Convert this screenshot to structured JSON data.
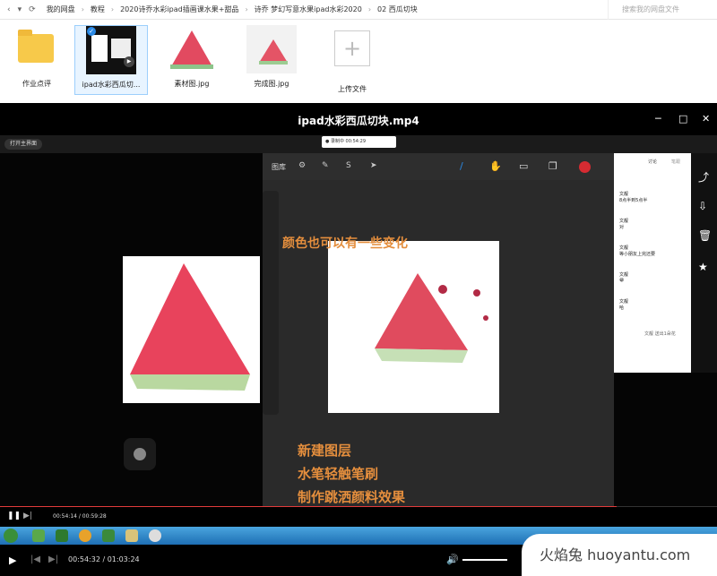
{
  "breadcrumb": [
    "我的网盘",
    "教程",
    "2020诗乔水彩ipad插画课水果+甜品",
    "诗乔 梦幻写意水果ipad水彩2020",
    "02 西瓜切块"
  ],
  "search": {
    "placeholder": "搜索我的网盘文件"
  },
  "files": [
    {
      "name": "作业点评",
      "kind": "folder"
    },
    {
      "name": "ipad水彩西瓜切...",
      "kind": "video"
    },
    {
      "name": "素材图.jpg",
      "kind": "image"
    },
    {
      "name": "完成图.jpg",
      "kind": "image"
    },
    {
      "name": "上传文件",
      "kind": "upload"
    }
  ],
  "video": {
    "title": "ipad水彩西瓜切块.mp4"
  },
  "recording": {
    "chip": "打开主界面",
    "time": "● 录制中 00:54:29"
  },
  "procreate": {
    "gallery": "图库"
  },
  "caption_top": "颜色也可以有一些变化",
  "caption_bottom": [
    "新建图层",
    "水笔轻触笔刷",
    "制作跳洒颜料效果"
  ],
  "chat": {
    "tabs": [
      "讨论",
      "笔跟"
    ],
    "messages": [
      {
        "user": "文靓",
        "text": "8点半到5点半"
      },
      {
        "user": "文靓",
        "text": "对"
      },
      {
        "user": "文靓",
        "text": "等小朋友上完还要"
      },
      {
        "user": "文靓",
        "text": "😁"
      },
      {
        "user": "文靓",
        "text": "哈"
      }
    ],
    "system": "文靓 送出1朵花"
  },
  "inner_time": "00:54:14 / 00:59:28",
  "player_time": "00:54:32 / 01:03:24",
  "progress": 0.86,
  "watermark": "火焰兔 huoyantu.com"
}
